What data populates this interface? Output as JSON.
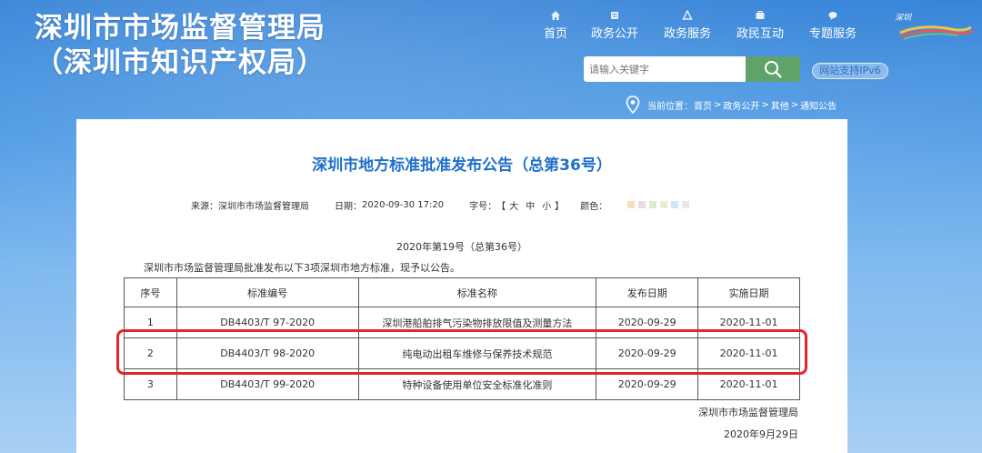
{
  "header": {
    "title_line1": "深圳市市场监督管理局",
    "title_line2": "（深圳市知识产权局）",
    "logo_text": "深圳"
  },
  "nav": [
    {
      "label": "首页",
      "icon": "home-icon"
    },
    {
      "label": "政务公开",
      "icon": "document-icon"
    },
    {
      "label": "政务服务",
      "icon": "service-icon"
    },
    {
      "label": "政民互动",
      "icon": "interaction-icon"
    },
    {
      "label": "专题服务",
      "icon": "topic-icon"
    }
  ],
  "search": {
    "placeholder": "请输入关键字",
    "button_icon": "search-icon"
  },
  "ipv6_badge": "网站支持IPv6",
  "breadcrumb": {
    "prefix": "当前位置：",
    "items": [
      "首页",
      "政务公开",
      "其他",
      "通知公告"
    ],
    "separator": ">"
  },
  "article": {
    "title": "深圳市地方标准批准发布公告（总第36号）",
    "source_label": "来源：",
    "source": "深圳市市场监督管理局",
    "date_label": "日期：",
    "date": "2020-09-30 17:20",
    "font_label": "字号：",
    "font_open": "【",
    "font_large": "大",
    "font_medium": "中",
    "font_small": "小",
    "font_close": "】",
    "color_label": "颜色：",
    "color_swatches": [
      "#f5e0b3",
      "#f2d6e0",
      "#dcebc9",
      "#e3f0d2",
      "#d6e4f3",
      "#e8e8e8"
    ],
    "doc_number": "2020年第19号（总第36号）",
    "intro": "深圳市市场监督管理局批准发布以下3项深圳市地方标准，现予以公告。",
    "table": {
      "headers": [
        "序号",
        "标准编号",
        "标准名称",
        "发布日期",
        "实施日期"
      ],
      "rows": [
        [
          "1",
          "DB4403/T 97-2020",
          "深圳港船舶排气污染物排放限值及测量方法",
          "2020-09-29",
          "2020-11-01"
        ],
        [
          "2",
          "DB4403/T 98-2020",
          "纯电动出租车维修与保养技术规范",
          "2020-09-29",
          "2020-11-01"
        ],
        [
          "3",
          "DB4403/T 99-2020",
          "特种设备使用单位安全标准化准则",
          "2020-09-29",
          "2020-11-01"
        ]
      ]
    },
    "signer": "深圳市市场监督管理局",
    "sign_date": "2020年9月29日"
  },
  "colors": {
    "title_blue": "#1d6fc9",
    "search_green": "#5fa36a",
    "highlight_red": "#e32626"
  }
}
